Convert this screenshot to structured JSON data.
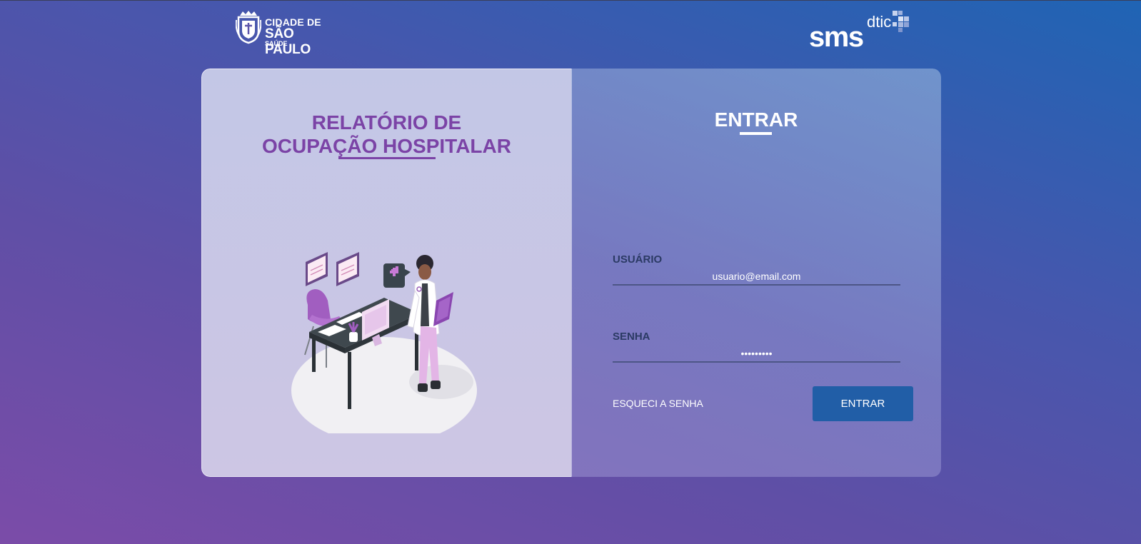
{
  "header": {
    "city_logo": {
      "line1": "CIDADE DE",
      "line2": "SÃO PAULO",
      "line3": "SAÚDE",
      "icon": "city-crest-icon"
    },
    "sms_logo": {
      "main": "sms",
      "sub": "dtic",
      "icon": "pixel-squares-icon"
    }
  },
  "left_panel": {
    "title_line1": "RELATÓRIO DE",
    "title_line2": "OCUPAÇÃO HOSPITALAR",
    "illustration": "doctor-at-desk-illustration"
  },
  "login": {
    "title": "ENTRAR",
    "username_label": "USUÁRIO",
    "username_value": "usuario@email.com",
    "password_label": "SENHA",
    "password_value": "123456789",
    "forgot_label": "ESQUECI A SENHA",
    "submit_label": "ENTRAR"
  },
  "colors": {
    "accent_purple": "#7b43a6",
    "button_blue": "#215ea7",
    "background_start": "#7b4ca8",
    "background_end": "#1f64b4"
  }
}
